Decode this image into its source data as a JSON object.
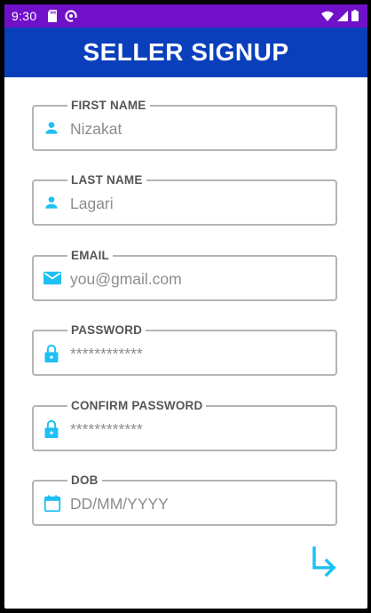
{
  "status_bar": {
    "time": "9:30",
    "icons": [
      "sd-card-icon",
      "data-saver-icon",
      "wifi-icon",
      "signal-icon",
      "battery-icon"
    ]
  },
  "app_bar": {
    "title": "SELLER SIGNUP"
  },
  "fields": [
    {
      "label": "FIRST NAME",
      "value": "Nizakat",
      "icon": "person-icon"
    },
    {
      "label": "LAST NAME",
      "value": "Lagari",
      "icon": "person-icon"
    },
    {
      "label": "EMAIL",
      "value": "you@gmail.com",
      "icon": "mail-icon"
    },
    {
      "label": "PASSWORD",
      "value": "************",
      "icon": "lock-icon"
    },
    {
      "label": "CONFIRM PASSWORD",
      "value": "************",
      "icon": "lock-icon"
    },
    {
      "label": "DOB",
      "value": "DD/MM/YYYY",
      "icon": "calendar-icon"
    }
  ],
  "actions": {
    "next_icon": "arrow-down-right-icon"
  },
  "colors": {
    "status_bar": "#7011c9",
    "app_bar": "#0a3fbb",
    "accent": "#1ec0f4",
    "field_border": "#b4b4b4",
    "label_text": "#555555",
    "value_text": "#8c8c8c"
  }
}
